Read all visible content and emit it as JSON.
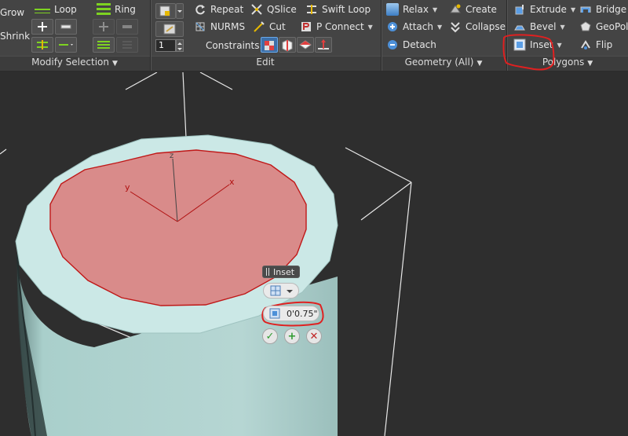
{
  "modify_selection": {
    "grow_label": "Grow",
    "shrink_label": "Shrink",
    "loop_label": "Loop",
    "ring_label": "Ring",
    "title": "Modify Selection"
  },
  "edit": {
    "repeat_label": "Repeat",
    "qslice_label": "QSlice",
    "swift_loop_label": "Swift Loop",
    "nurms_label": "NURMS",
    "cut_label": "Cut",
    "p_connect_label": "P Connect",
    "constraints_label": "Constraints:",
    "spinner_value": "1",
    "title": "Edit"
  },
  "geometry": {
    "relax_label": "Relax",
    "create_label": "Create",
    "attach_label": "Attach",
    "collapse_label": "Collapse",
    "detach_label": "Detach",
    "title": "Geometry (All)"
  },
  "polygons": {
    "extrude_label": "Extrude",
    "bridge_label": "Bridge",
    "bevel_label": "Bevel",
    "geopoly_label": "GeoPoly",
    "inset_label": "Inset",
    "flip_label": "Flip",
    "title": "Polygons"
  },
  "caddy": {
    "title": "Inset",
    "amount_value": "0'0.75\""
  },
  "gizmo": {
    "x_label": "x",
    "y_label": "y",
    "z_label": "z"
  },
  "colors": {
    "ribbon_bg": "#444444",
    "viewport_bg": "#2e2e2e",
    "cylinder_side": "#a9cfcb",
    "cylinder_rim": "#cbe8e6",
    "selected_face": "#d98b8a",
    "annotation_red": "#e02020",
    "accent_orange": "#c8a040"
  }
}
